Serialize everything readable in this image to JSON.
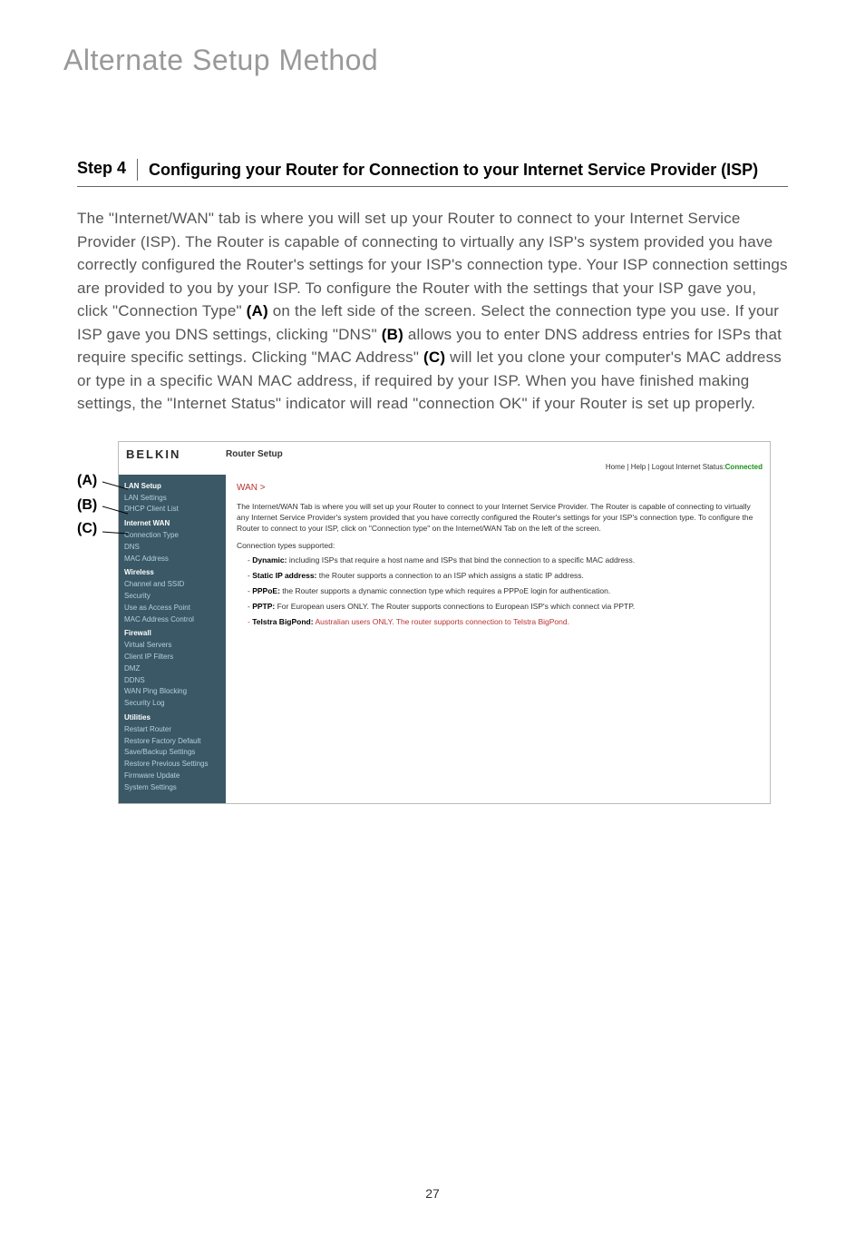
{
  "page": {
    "title": "Alternate Setup Method",
    "number": "27"
  },
  "step": {
    "label": "Step 4",
    "title": "Configuring your Router for Connection to your Internet Service Provider (ISP)",
    "body_1": "The \"Internet/WAN\" tab is where you will set up your Router to connect to your Internet Service Provider (ISP). The Router is capable of connecting to virtually any ISP's system provided you have correctly configured the Router's settings for your ISP's connection type. Your ISP connection settings are provided to you by your ISP. To configure the Router with the settings that your ISP gave you, click \"Connection Type\" ",
    "bold_a": "(A)",
    "body_2": " on the left side of the screen. Select the connection type you use. If your ISP gave you DNS settings, clicking \"DNS\" ",
    "bold_b": "(B)",
    "body_3": " allows you to enter DNS address entries for ISPs that require specific settings. Clicking \"MAC Address\" ",
    "bold_c": "(C)",
    "body_4": " will let you clone your computer's MAC address or type in a specific WAN MAC address, if required by your ISP. When you have finished making settings, the \"Internet Status\" indicator will read \"connection OK\" if your Router is set up properly."
  },
  "callouts": {
    "a": "(A)",
    "b": "(B)",
    "c": "(C)"
  },
  "router": {
    "logo": "BELKIN",
    "title": "Router Setup",
    "toplinks": "Home | Help | Logout   Internet Status: ",
    "status": "Connected",
    "sidebar": {
      "s1": "LAN Setup",
      "i1a": "LAN Settings",
      "i1b": "DHCP Client List",
      "s2": "Internet WAN",
      "i2a": "Connection Type",
      "i2b": "DNS",
      "i2c": "MAC Address",
      "s3": "Wireless",
      "i3a": "Channel and SSID",
      "i3b": "Security",
      "i3c": "Use as Access Point",
      "i3d": "MAC Address Control",
      "s4": "Firewall",
      "i4a": "Virtual Servers",
      "i4b": "Client IP Filters",
      "i4c": "DMZ",
      "i4d": "DDNS",
      "i4e": "WAN Ping Blocking",
      "i4f": "Security Log",
      "s5": "Utilities",
      "i5a": "Restart Router",
      "i5b": "Restore Factory Default",
      "i5c": "Save/Backup Settings",
      "i5d": "Restore Previous Settings",
      "i5e": "Firmware Update",
      "i5f": "System Settings"
    },
    "main": {
      "breadcrumb": "WAN >",
      "intro": "The Internet/WAN Tab is where you will set up your Router to connect to your Internet Service Provider. The Router is capable of connecting to virtually any Internet Service Provider's system provided that you have correctly configured the Router's settings for your ISP's connection type. To configure the Router to connect to your ISP, click on \"Connection type\" on the Internet/WAN Tab on the left of the screen.",
      "subhead": "Connection types supported:",
      "li1b": "Dynamic:",
      "li1": " including ISPs that require a host name and ISPs that bind the connection to a specific MAC address.",
      "li2b": "Static IP address:",
      "li2": " the Router supports a connection to an ISP which assigns a static IP address.",
      "li3b": "PPPoE:",
      "li3": " the Router supports a dynamic connection type which requires a PPPoE login for authentication.",
      "li4b": "PPTP:",
      "li4": " For European users ONLY. The Router supports connections to European ISP's which connect via PPTP.",
      "li5b": "Telstra BigPond:",
      "li5": " Australian users ONLY. The router supports connection to Telstra BigPond."
    }
  }
}
